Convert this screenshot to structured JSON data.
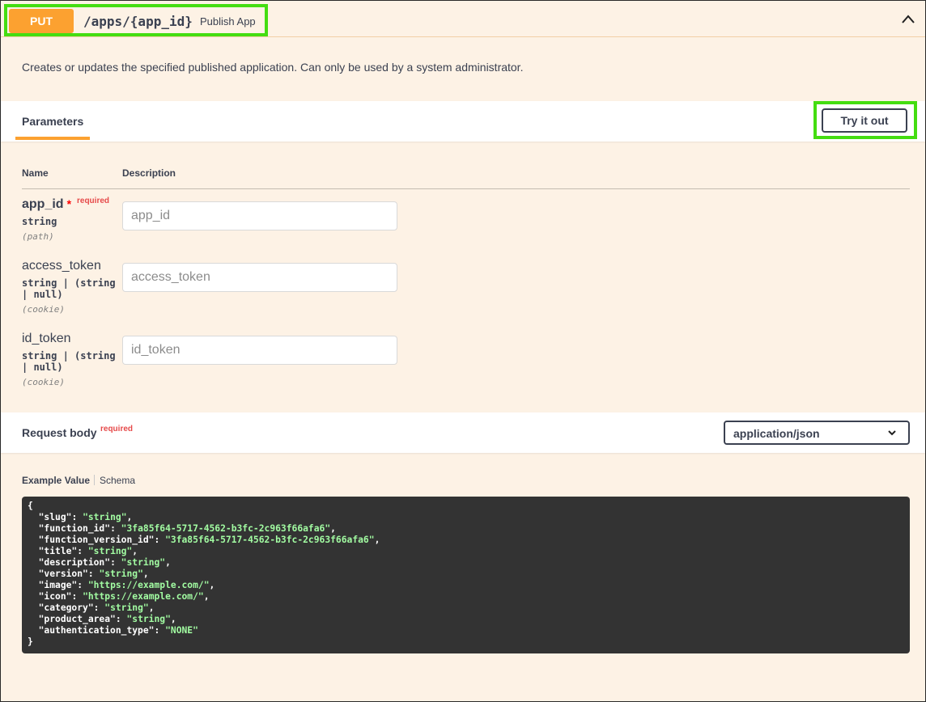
{
  "operation": {
    "method": "PUT",
    "path": "/apps/{app_id}",
    "summary": "Publish App",
    "description": "Creates or updates the specified published application. Can only be used by a system administrator."
  },
  "parameters_section": {
    "title": "Parameters",
    "try_button": "Try it out",
    "col_name": "Name",
    "col_description": "Description",
    "items": [
      {
        "name": "app_id",
        "required_mark": "*",
        "required_label": "required",
        "type": "string",
        "in": "(path)",
        "placeholder": "app_id"
      },
      {
        "name": "access_token",
        "type": "string | (string | null)",
        "in": "(cookie)",
        "placeholder": "access_token"
      },
      {
        "name": "id_token",
        "type": "string | (string | null)",
        "in": "(cookie)",
        "placeholder": "id_token"
      }
    ]
  },
  "request_body": {
    "title": "Request body",
    "required_label": "required",
    "content_type": "application/json",
    "tab_example": "Example Value",
    "tab_schema": "Schema",
    "example_open": "{",
    "example_close": "}",
    "example_fields": [
      {
        "key": "slug",
        "value": "string"
      },
      {
        "key": "function_id",
        "value": "3fa85f64-5717-4562-b3fc-2c963f66afa6"
      },
      {
        "key": "function_version_id",
        "value": "3fa85f64-5717-4562-b3fc-2c963f66afa6"
      },
      {
        "key": "title",
        "value": "string"
      },
      {
        "key": "description",
        "value": "string"
      },
      {
        "key": "version",
        "value": "string"
      },
      {
        "key": "image",
        "value": "https://example.com/"
      },
      {
        "key": "icon",
        "value": "https://example.com/"
      },
      {
        "key": "category",
        "value": "string"
      },
      {
        "key": "product_area",
        "value": "string"
      },
      {
        "key": "authentication_type",
        "value": "NONE"
      }
    ]
  },
  "colors": {
    "method_put": "#fca130",
    "block_background": "#fdf2e5",
    "highlight": "#44dd11",
    "code_background": "#333333",
    "code_string": "#a2fca2",
    "required": "#e64a4a"
  },
  "icons": {
    "collapse": "chevron-up-icon",
    "select": "chevron-down-icon"
  }
}
